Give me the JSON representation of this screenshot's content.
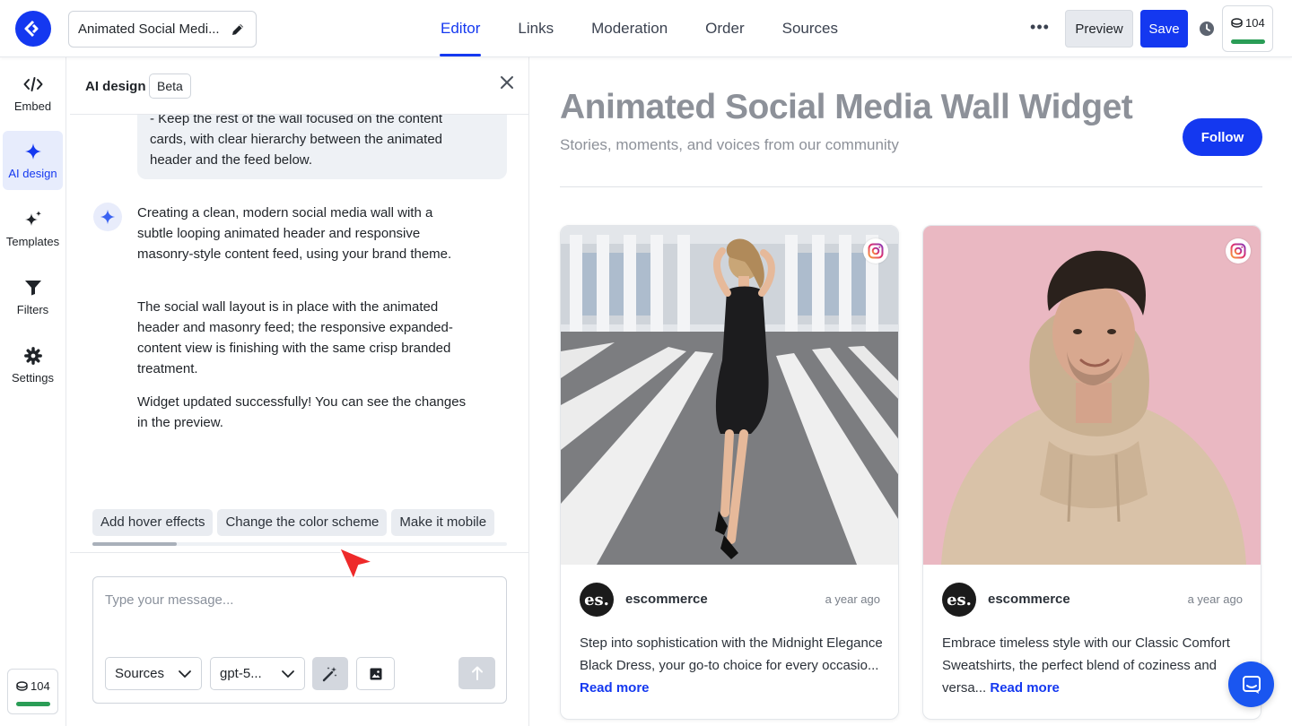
{
  "header": {
    "widget_title": "Animated Social Medi...",
    "tabs": [
      {
        "label": "Editor",
        "active": true
      },
      {
        "label": "Links",
        "active": false
      },
      {
        "label": "Moderation",
        "active": false
      },
      {
        "label": "Order",
        "active": false
      },
      {
        "label": "Sources",
        "active": false
      }
    ],
    "more_label": "•••",
    "preview_label": "Preview",
    "save_label": "Save",
    "credits": "104",
    "accent_color": "#1438f0",
    "credit_bar_color": "#2a9d56"
  },
  "sidebar": {
    "items": [
      {
        "label": "Embed",
        "icon": "code-icon",
        "active": false
      },
      {
        "label": "AI design",
        "icon": "sparkle-icon",
        "active": true
      },
      {
        "label": "Templates",
        "icon": "sparkles-icon",
        "active": false
      },
      {
        "label": "Filters",
        "icon": "filter-icon",
        "active": false
      },
      {
        "label": "Settings",
        "icon": "gear-icon",
        "active": false
      }
    ],
    "credits": "104"
  },
  "ai_panel": {
    "title": "AI design",
    "badge": "Beta",
    "user_message_lines": [
      "- Keep the rest of the wall focused on the content",
      "cards, with clear hierarchy between the animated",
      "header and the feed below."
    ],
    "assistant_messages": [
      "Creating a clean, modern social media wall with a subtle looping animated header and responsive masonry-style content feed, using your brand theme.",
      "The social wall layout is in place with the animated header and masonry feed; the responsive expanded-content view is finishing with the same crisp branded treatment.",
      "Widget updated successfully! You can see the changes in the preview."
    ],
    "suggestions": [
      "Add hover effects",
      "Change the color scheme",
      "Make it mobile"
    ],
    "composer": {
      "placeholder": "Type your message...",
      "source_select": "Sources",
      "model_select": "gpt-5..."
    }
  },
  "preview": {
    "title": "Animated Social Media Wall Widget",
    "subtitle": "Stories, moments, and voices from our community",
    "follow_label": "Follow",
    "posts": [
      {
        "username": "escommerce",
        "avatar_text": "es.",
        "time": "a year ago",
        "text": "Step into sophistication with the Midnight Elegance Black Dress, your go-to choice for every occasio...",
        "read_more": "Read more",
        "source_icon": "instagram-icon"
      },
      {
        "username": "escommerce",
        "avatar_text": "es.",
        "time": "a year ago",
        "text": "Embrace timeless style with our Classic Comfort Sweatshirts, the perfect blend of coziness and versa...",
        "read_more": "Read more",
        "source_icon": "instagram-icon"
      }
    ]
  }
}
